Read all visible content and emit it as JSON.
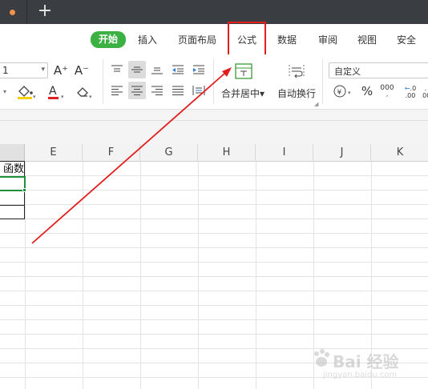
{
  "titlebar": {
    "new_tab_glyph": "+"
  },
  "menu": {
    "tabs": [
      "开始",
      "插入",
      "页面布局",
      "公式",
      "数据",
      "审阅",
      "视图",
      "安全"
    ],
    "active": "开始",
    "highlighted": "公式"
  },
  "toolbar": {
    "font_size": "1",
    "font_size_caret": "▾",
    "grow_font": "A⁺",
    "shrink_font": "A⁻",
    "merge_label": "合并居中▾",
    "wrap_label": "自动换行",
    "number_format": "自定义",
    "currency_symbol": "¥",
    "percent_symbol": "%",
    "thousands_symbol": "000",
    "inc_decimal": ".00",
    "dec_decimal": ".00",
    "icons": [
      "fill-color-icon",
      "font-color-icon",
      "eraser-icon",
      "align-top-icon",
      "align-middle-icon",
      "align-bottom-icon",
      "indent-decrease-icon",
      "indent-increase-icon",
      "align-left-icon",
      "align-center-icon",
      "align-right-icon",
      "justify-icon",
      "distribute-icon",
      "merge-center-icon",
      "wrap-text-icon"
    ]
  },
  "columns": [
    "E",
    "F",
    "G",
    "H",
    "I",
    "J",
    "K"
  ],
  "cells": {
    "partial_header": "函数"
  },
  "colors": {
    "accent_green": "#3cb043",
    "highlight_red": "#e21d1d",
    "selection_green": "#1f8f3a"
  },
  "watermark": {
    "text": "Bai 经验",
    "url": "jingyan.baidu.com"
  }
}
